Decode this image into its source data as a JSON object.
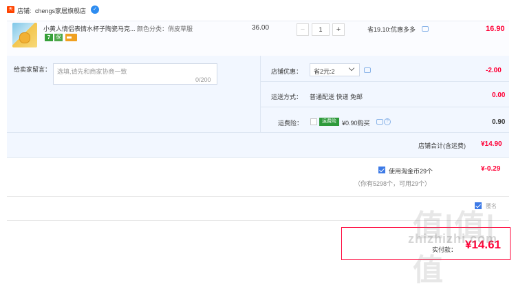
{
  "store": {
    "icon_label": "天猫",
    "label": "店铺:",
    "name": "chengs家居旗舰店",
    "contact_icon": "wangwang-chat-icon"
  },
  "item": {
    "title": "小黄人情侣表情水杯子陶瓷马克...",
    "sku": "颜色分类：俏皮草服",
    "badge_7": "7",
    "badge_bao": "保",
    "unit_price": "36.00",
    "qty_minus": "−",
    "qty": "1",
    "qty_plus": "+",
    "discount": "省19.10:优惠多多",
    "total": "16.90"
  },
  "options": {
    "message_label": "给卖家留言：",
    "message_placeholder": "选填,请先和商家协商一致",
    "message_count": "0/200",
    "coupon_label": "店铺优惠：",
    "coupon_value": "省2元:2",
    "coupon_amount": "-2.00",
    "shipping_label": "运送方式：",
    "shipping_value": "普通配送 快递 免邮",
    "shipping_amount": "0.00",
    "insurance_label": "运费险：",
    "insurance_tag": "运费险",
    "insurance_value": "¥0.90购买",
    "insurance_amount": "0.90",
    "store_total_label": "店铺合计(含运费)",
    "store_total": "¥14.90"
  },
  "coins": {
    "label": "使用淘金币29个",
    "checked": true,
    "amount": "¥-0.29",
    "sub": "（你有5298个，可用29个）"
  },
  "footer": {
    "anon_faint": "匿名",
    "pay_label": "实付款：",
    "pay_currency": "¥",
    "pay_amount": "14.61",
    "watermark_big": "值|值|值",
    "watermark_small": "zhizhizhi.com"
  },
  "colors": {
    "accent_red": "#ff0036",
    "panel_blue": "#f2f7ff",
    "check_blue": "#3d7ae6"
  }
}
